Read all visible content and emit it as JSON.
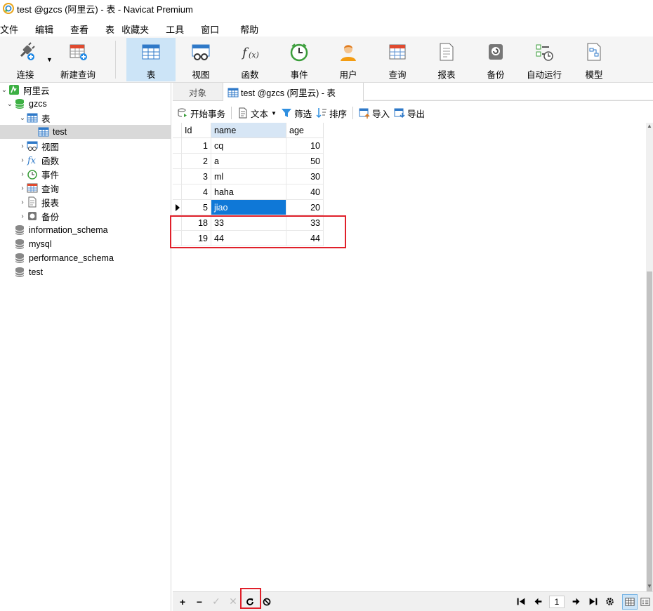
{
  "window": {
    "title": "test @gzcs (阿里云) - 表 - Navicat Premium"
  },
  "menu": [
    "文件",
    "编辑",
    "查看",
    "表",
    "收藏夹",
    "工具",
    "窗口",
    "帮助"
  ],
  "toolbar": {
    "connect": "连接",
    "new_query": "新建查询",
    "table": "表",
    "view": "视图",
    "function": "函数",
    "event": "事件",
    "user": "用户",
    "query": "查询",
    "report": "报表",
    "backup": "备份",
    "auto_run": "自动运行",
    "model": "模型"
  },
  "tree": {
    "connection": "阿里云",
    "database": "gzcs",
    "tables_node": "表",
    "table_test": "test",
    "views": "视图",
    "functions": "函数",
    "events": "事件",
    "queries": "查询",
    "reports": "报表",
    "backups": "备份",
    "other_dbs": [
      "information_schema",
      "mysql",
      "performance_schema",
      "test"
    ]
  },
  "tabs": {
    "objects": "对象",
    "current": "test @gzcs (阿里云) - 表"
  },
  "subtoolbar": {
    "begin_transaction": "开始事务",
    "text": "文本",
    "filter": "筛选",
    "sort": "排序",
    "import": "导入",
    "export": "导出"
  },
  "grid": {
    "columns": [
      "Id",
      "name",
      "age"
    ],
    "rows": [
      {
        "id": "1",
        "name": "cq",
        "age": "10"
      },
      {
        "id": "2",
        "name": "a",
        "age": "50"
      },
      {
        "id": "3",
        "name": "ml",
        "age": "30"
      },
      {
        "id": "4",
        "name": "haha",
        "age": "40"
      },
      {
        "id": "5",
        "name": "jiao",
        "age": "20"
      },
      {
        "id": "18",
        "name": "33",
        "age": "33"
      },
      {
        "id": "19",
        "name": "44",
        "age": "44"
      }
    ],
    "current_row_index": 4
  },
  "pagination": {
    "page": "1"
  },
  "colors": {
    "selection": "#0f78d7",
    "highlight_box": "#e0202a",
    "active_toolbar": "#cce4f7"
  }
}
